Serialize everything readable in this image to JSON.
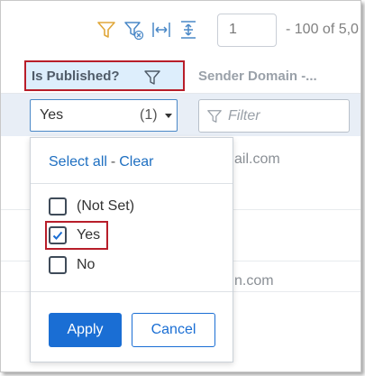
{
  "toolbar": {
    "icons": [
      "filter-icon",
      "clear-filter-icon",
      "fit-columns-icon",
      "fit-rows-icon"
    ],
    "page_input_value": "1",
    "page_range_text": "- 100 of 5,0"
  },
  "columns": {
    "published_header": "Is Published?",
    "sender_header": "Sender Domain -..."
  },
  "filters": {
    "published_value": "Yes",
    "published_count": "(1)",
    "sender_placeholder": "Filter"
  },
  "rows": {
    "partial_texts": [
      "ail.com",
      "n.com"
    ]
  },
  "popup": {
    "select_all_label": "Select all",
    "separator": "-",
    "clear_label": "Clear",
    "options": [
      {
        "label": "(Not Set)",
        "checked": false
      },
      {
        "label": "Yes",
        "checked": true
      },
      {
        "label": "No",
        "checked": false
      }
    ],
    "apply_label": "Apply",
    "cancel_label": "Cancel"
  },
  "colors": {
    "accent": "#1a6ed4",
    "filter_icon_active": "#e0a73a",
    "highlight_border": "#b81e2a",
    "header_selected_bg": "#ddeefc"
  }
}
